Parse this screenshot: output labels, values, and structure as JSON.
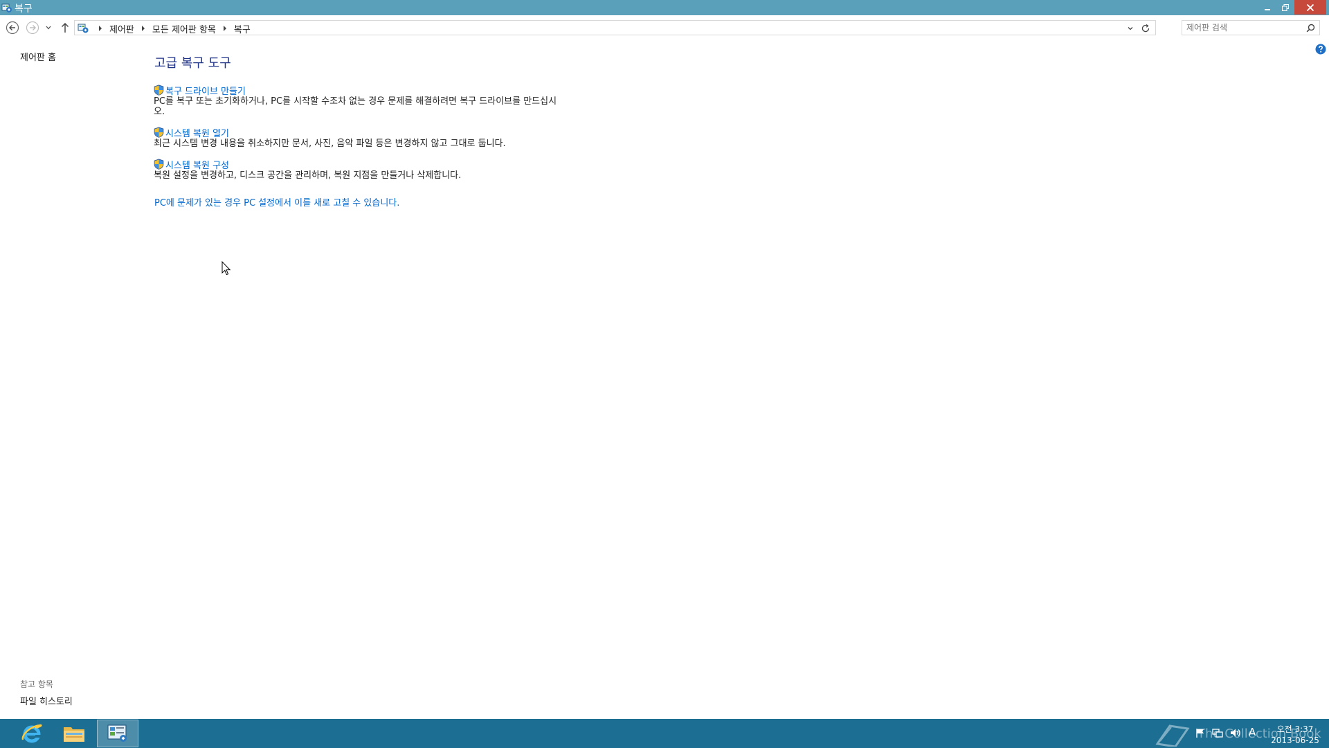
{
  "window": {
    "title": "복구",
    "minimize_label": "최소화",
    "maximize_label": "이전 크기로",
    "close_label": "닫기"
  },
  "address_bar": {
    "breadcrumbs": [
      "제어판",
      "모든 제어판 항목",
      "복구"
    ]
  },
  "search": {
    "placeholder": "제어판 검색"
  },
  "left_pane": {
    "home_link": "제어판 홈",
    "see_also_title": "참고 항목",
    "see_also_items": [
      "파일 히스토리"
    ]
  },
  "main": {
    "title": "고급 복구 도구",
    "tasks": [
      {
        "link": "복구 드라이브 만들기",
        "description": "PC를 복구 또는 초기화하거나, PC를 시작할 수조차 없는 경우 문제를 해결하려면 복구 드라이브를 만드십시오."
      },
      {
        "link": "시스템 복원 열기",
        "description": "최근 시스템 변경 내용을 취소하지만 문서, 사진, 음악 파일 등은 변경하지 않고 그대로 둡니다."
      },
      {
        "link": "시스템 복원 구성",
        "description": "복원 설정을 변경하고, 디스크 공간을 관리하며, 복원 지점을 만들거나 삭제합니다."
      }
    ],
    "pc_settings_link": "PC에 문제가 있는 경우 PC 설정에서 이를 새로 고칠 수 있습니다."
  },
  "taskbar": {
    "apps": [
      "internet-explorer-icon",
      "file-explorer-icon",
      "control-panel-icon"
    ],
    "watermark": "The Collection Book",
    "ime": "A",
    "clock_time": "오전 3:37",
    "clock_date": "2013-06-25"
  },
  "colors": {
    "titlebar": "#5aa0bb",
    "close_button": "#c7493c",
    "taskbar": "#1c6e92",
    "link": "#0066cc",
    "heading": "#1e3287"
  }
}
